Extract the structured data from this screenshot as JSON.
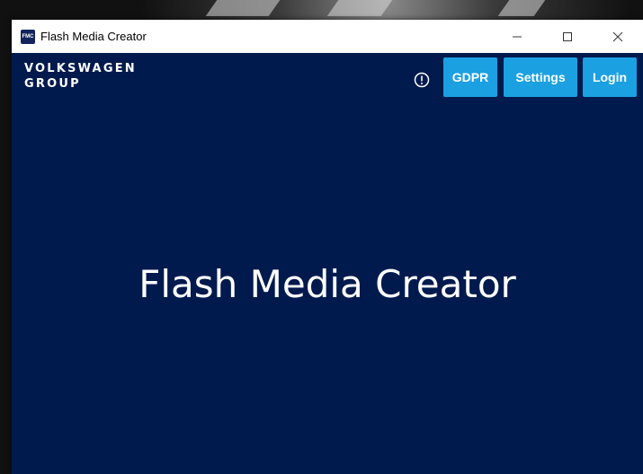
{
  "window": {
    "title": "Flash Media Creator",
    "icon_label": "FMC",
    "controls": [
      "minimize",
      "maximize",
      "close"
    ]
  },
  "brand": {
    "line1": "VOLKSWAGEN",
    "line2": "GROUP"
  },
  "header": {
    "buttons": [
      {
        "label": "GDPR"
      },
      {
        "label": "Settings"
      },
      {
        "label": "Login"
      }
    ],
    "info_icon": "info-circle-icon"
  },
  "main": {
    "title": "Flash Media Creator"
  },
  "colors": {
    "app_background": "#001a4d",
    "button": "#1ba0e2",
    "titlebar": "#ffffff"
  }
}
